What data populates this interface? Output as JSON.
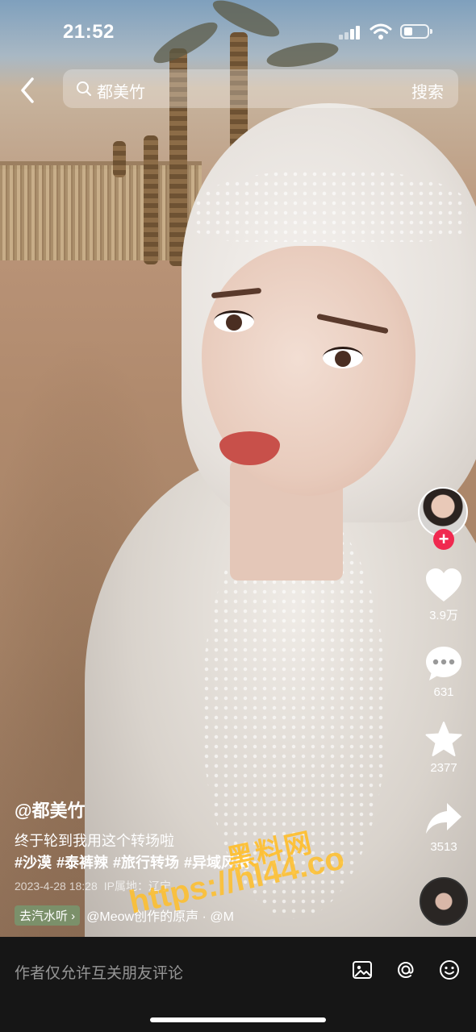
{
  "status_bar": {
    "time": "21:52"
  },
  "header": {
    "search_text": "都美竹",
    "search_button": "搜索"
  },
  "actions": {
    "likes": "3.9万",
    "comments": "631",
    "favorites": "2377",
    "shares": "3513"
  },
  "caption": {
    "author": "@都美竹",
    "description": "终于轮到我用这个转场啦",
    "tags": [
      "#沙漠",
      "#泰裤辣",
      "#旅行转场",
      "#异域风情"
    ],
    "date": "2023-4-28 18:28",
    "ip": "IP属地：辽宁"
  },
  "music": {
    "tag": "去汽水听",
    "text": "@Meow创作的原声 · @M"
  },
  "watermark": {
    "line1": "黑料网",
    "line2": "https://hl44.co"
  },
  "bottom_bar": {
    "comment_placeholder": "作者仅允许互关朋友评论"
  },
  "colors": {
    "follow_red": "#f0294f",
    "watermark": "#ffbe28",
    "bar_bg": "#161616"
  }
}
